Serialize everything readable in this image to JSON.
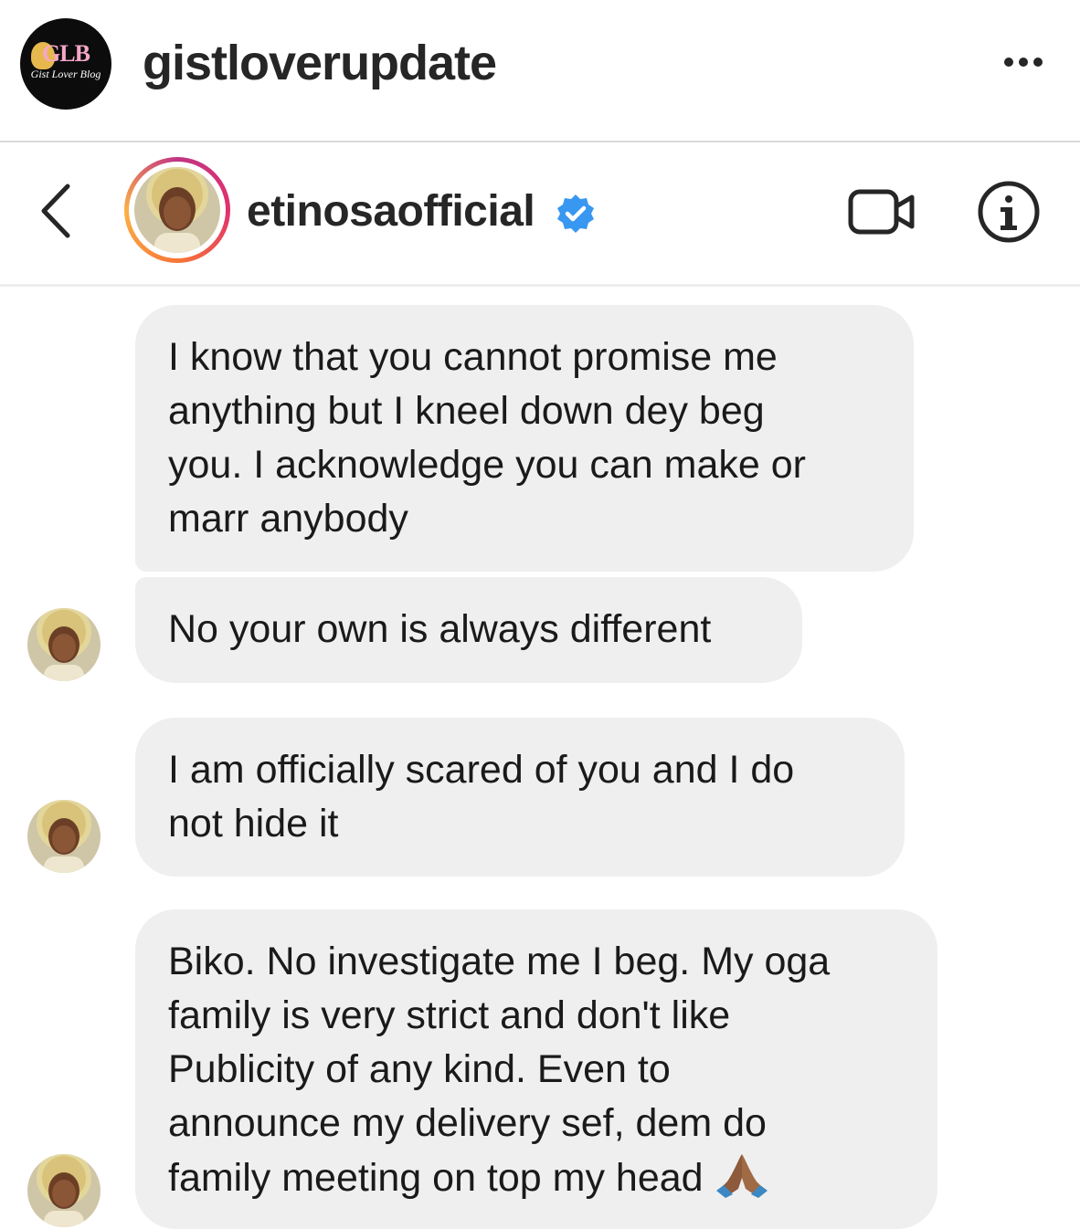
{
  "post": {
    "username": "gistloverupdate",
    "avatar_logo": "GLB",
    "avatar_logo_sub": "Gist Lover Blog",
    "more_icon": "more-horizontal-icon"
  },
  "dm_header": {
    "username": "etinosaofficial",
    "verified": true,
    "back_icon": "chevron-left-icon",
    "video_icon": "video-camera-icon",
    "info_icon": "info-icon",
    "ring_colors": [
      "#c13584",
      "#e1306c",
      "#f77737",
      "#fcaf45"
    ],
    "verified_color": "#3897f0"
  },
  "messages": [
    {
      "text": "I know that you cannot promise me\nanything but I kneel down dey beg\nyou. I acknowledge you can make or\nmarr anybody"
    },
    {
      "text": "No your own is always different"
    },
    {
      "text": "I am officially scared of you and I do\nnot hide it"
    },
    {
      "text": "Biko. No investigate me I beg. My oga\nfamily is very strict and don't like\nPublicity of any kind. Even to\nannounce my delivery sef, dem do\nfamily meeting on top my head ",
      "emoji": "folded-hands-emoji"
    }
  ],
  "colors": {
    "bubble_bg": "#efefef",
    "text": "#1a1a1a"
  }
}
